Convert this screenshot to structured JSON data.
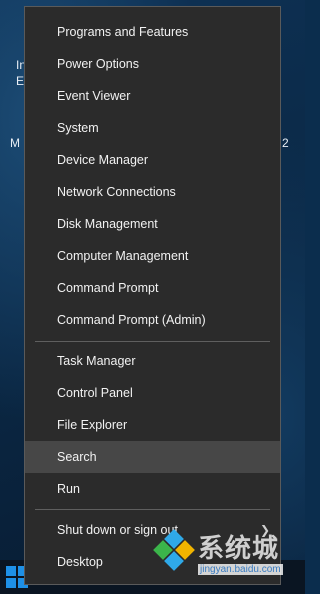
{
  "desktop": {
    "text_1": "In",
    "text_2": "E",
    "text_3": "M",
    "text_4": "2"
  },
  "menu": {
    "group1": [
      "Programs and Features",
      "Power Options",
      "Event Viewer",
      "System",
      "Device Manager",
      "Network Connections",
      "Disk Management",
      "Computer Management",
      "Command Prompt",
      "Command Prompt (Admin)"
    ],
    "group2": [
      "Task Manager",
      "Control Panel",
      "File Explorer",
      "Search",
      "Run"
    ],
    "group3": [
      "Shut down or sign out",
      "Desktop"
    ],
    "highlighted": "Search"
  },
  "watermark": {
    "brand": "系统城",
    "url": "jingyan.baidu.com"
  },
  "colors": {
    "menu_bg": "#2b2b2b",
    "highlight": "#474747",
    "start_blue": "#1e90e6"
  }
}
